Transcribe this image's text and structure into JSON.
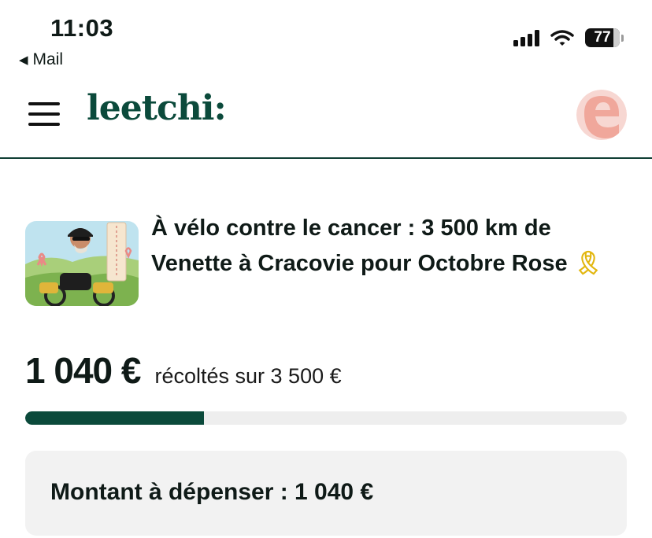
{
  "status_bar": {
    "time": "11:03",
    "back_app": "Mail",
    "battery": "77"
  },
  "header": {
    "logo": "leetchi:",
    "menu_icon": "hamburger-icon",
    "avatar_icon": "user-avatar-e"
  },
  "campaign": {
    "title": "À vélo contre le cancer : 3 500 km de Venette à Cracovie pour Octobre Rose",
    "title_emoji": "🎗",
    "raised": "1 040 €",
    "raised_caption": "récoltés sur 3 500 €",
    "progress_percent": 29.7,
    "spend_label": "Montant à dépenser : 1 040 €"
  },
  "colors": {
    "brand": "#0b4a3b",
    "avatar_bg": "#f7d7d2",
    "avatar_accent": "#f0a79b"
  }
}
